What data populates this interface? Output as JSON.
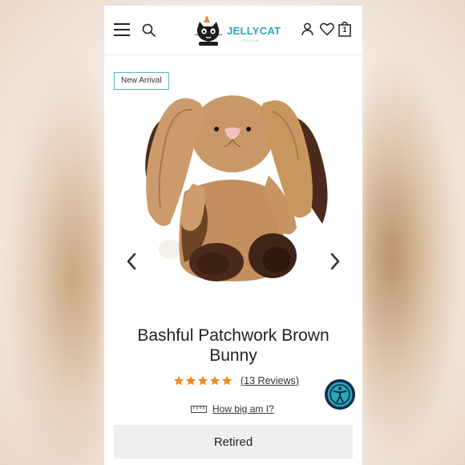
{
  "header": {
    "brand_name": "JELLYCAT",
    "brand_sub": "LONDON",
    "icons": [
      "menu-icon",
      "search-icon",
      "account-icon",
      "heart-icon",
      "bag-icon"
    ],
    "bag_count": "1"
  },
  "product": {
    "badge": "New Arrival",
    "title_line1": "Bashful Patchwork Brown",
    "title_line2": "Bunny",
    "rating": 5,
    "reviews_label": "(13 Reviews)",
    "size_label": "How big am I?",
    "status_label": "Retired"
  },
  "colors": {
    "accent": "#29a9b8",
    "star": "#f08a24",
    "fur_light": "#c9976a",
    "fur_dark": "#4a2a1a",
    "a11y_ring": "#0b2a4a",
    "a11y_fill": "#2ba7b5"
  }
}
